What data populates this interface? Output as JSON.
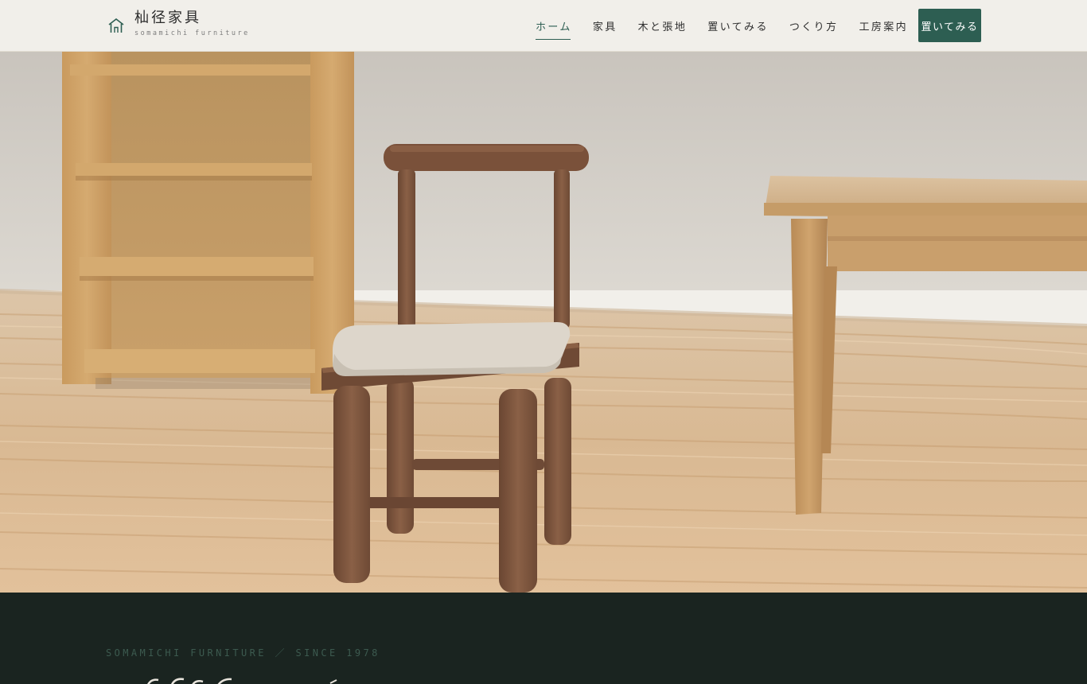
{
  "brand": {
    "name": "杣径家具",
    "subtitle": "somamichi furniture"
  },
  "nav": {
    "items": [
      {
        "label": "ホーム",
        "active": true
      },
      {
        "label": "家具"
      },
      {
        "label": "木と張地"
      },
      {
        "label": "置いてみる"
      },
      {
        "label": "つくり方"
      },
      {
        "label": "工房案内"
      }
    ],
    "cta_label": "置いてみる"
  },
  "colors": {
    "accent": "#2d5e52",
    "header_bg": "#f1efea",
    "dark_bg": "#1a2420"
  },
  "intro": {
    "eyebrow": "SOMAMICHI FURNITURE ／ SINCE 1978"
  },
  "icons": {
    "logo": "house-outline-icon"
  }
}
